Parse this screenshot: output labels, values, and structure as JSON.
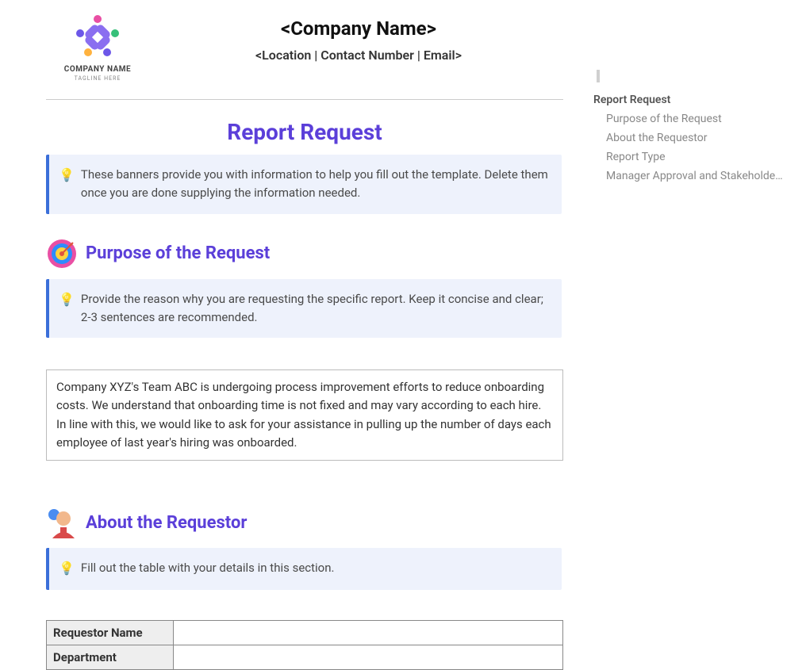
{
  "header": {
    "company_name": "<Company Name>",
    "subline": "<Location | Contact Number | Email>",
    "logo_text_main": "COMPANY NAME",
    "logo_text_tag": "TAGLINE HERE"
  },
  "doc_title": "Report Request",
  "banners": {
    "intro": "These banners provide you with information to help you fill out the template. Delete them once you are done supplying the information needed.",
    "purpose": "Provide the reason why you are requesting the specific report. Keep it concise and clear; 2-3 sentences are recommended.",
    "requestor": "Fill out the table with your details in this section."
  },
  "sections": {
    "purpose_title": "Purpose of the Request",
    "purpose_body": "Company XYZ's Team ABC is undergoing process improvement efforts to reduce onboarding costs. We understand that onboarding time is not fixed and may vary according to each hire. In line with this, we would like to ask for your assistance in pulling up the number of days each employee of last year's hiring was onboarded.",
    "requestor_title": "About the Requestor"
  },
  "table": {
    "rows": [
      {
        "label": "Requestor Name",
        "value": ""
      },
      {
        "label": "Department",
        "value": ""
      }
    ]
  },
  "toc": {
    "h1": "Report Request",
    "items": [
      "Purpose of the Request",
      "About the Requestor",
      "Report Type",
      "Manager Approval and Stakeholder I..."
    ]
  }
}
